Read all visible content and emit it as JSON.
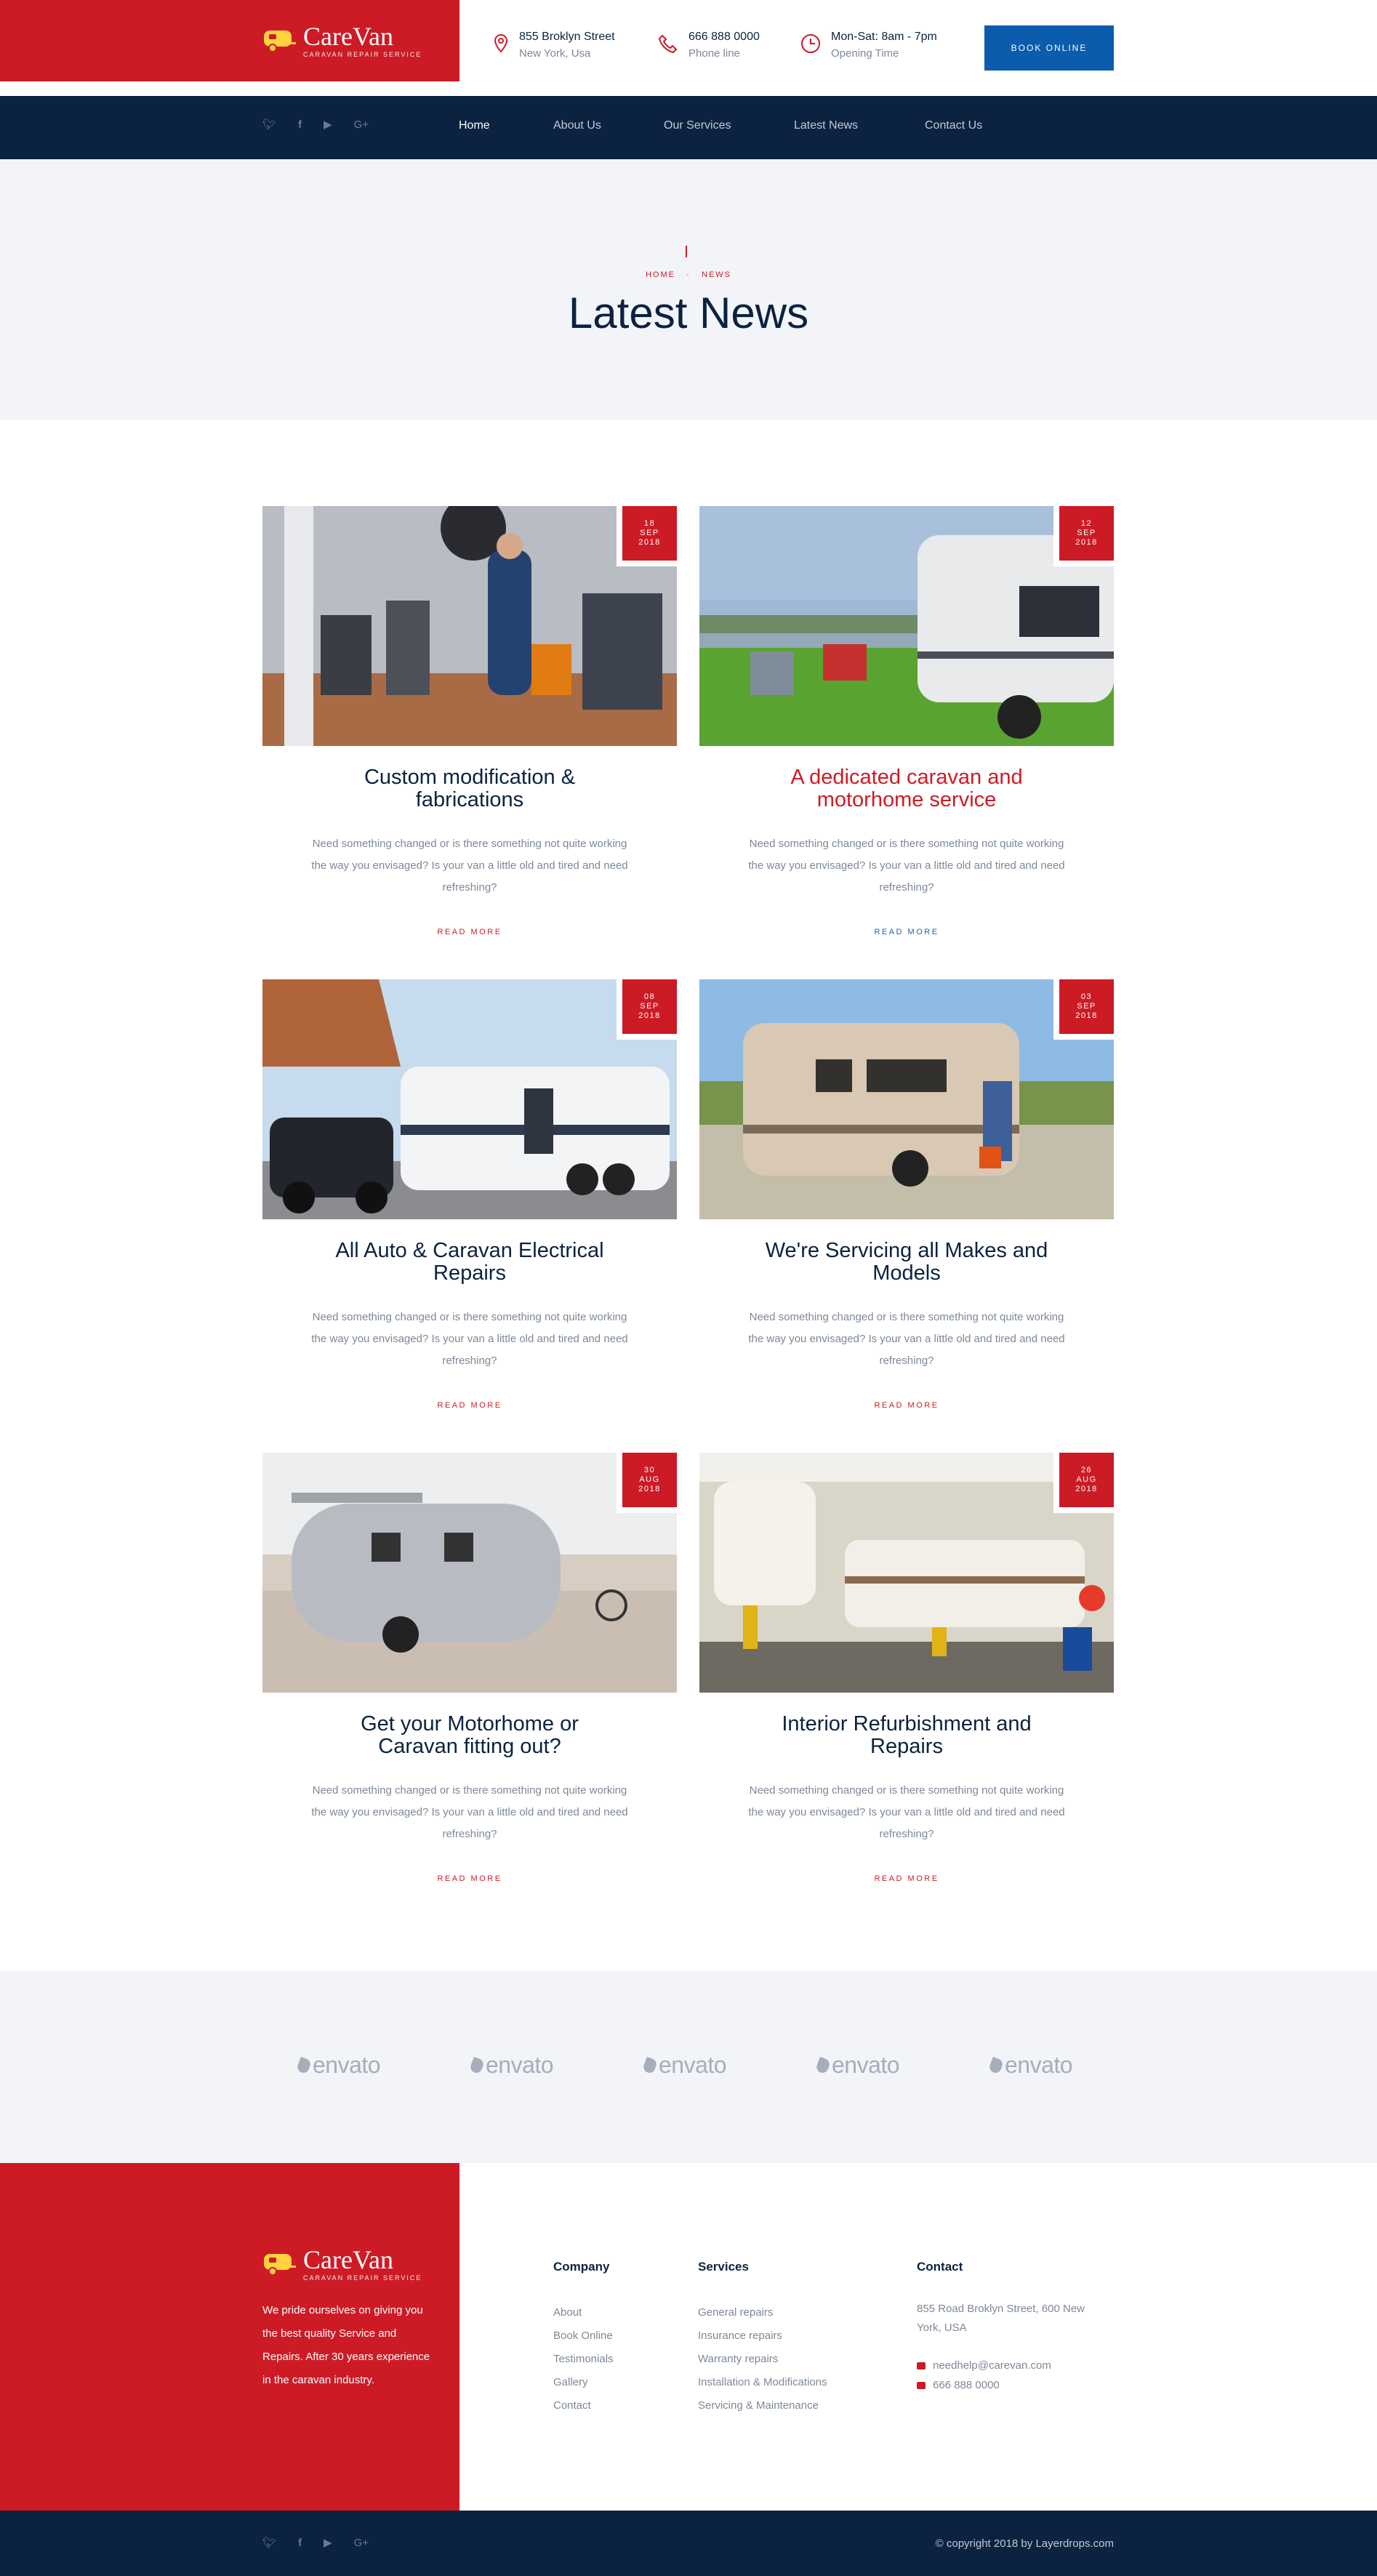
{
  "brand": {
    "name": "CareVan",
    "tagline": "Caravan Repair Service",
    "logo_color": "#ffd23e"
  },
  "colors": {
    "red": "#cd1b26",
    "navy": "#0b2240",
    "blue": "#0b5cad",
    "light": "#f2f4f8"
  },
  "header": {
    "address": {
      "line1": "855 Broklyn Street",
      "line2": "New York, Usa",
      "icon": "map-pin-icon"
    },
    "phone": {
      "line1": "666 888 0000",
      "line2": "Phone line",
      "icon": "phone-icon"
    },
    "hours": {
      "line1": "Mon-Sat: 8am - 7pm",
      "line2": "Opening Time",
      "icon": "clock-icon"
    },
    "book_label": "BOOK ONLINE"
  },
  "social": [
    "twitter",
    "facebook",
    "youtube",
    "google-plus"
  ],
  "nav": [
    "Home",
    "About Us",
    "Our Services",
    "Latest News",
    "Contact Us"
  ],
  "hero": {
    "breadcrumb_home": "HOME",
    "breadcrumb_current": "NEWS",
    "title": "Latest News"
  },
  "posts": [
    {
      "day": "18",
      "month": "SEP",
      "year": "2018",
      "title": "Custom modification & fabrications",
      "desc": "Need something changed or is there something not quite working the way you envisaged? Is your van a little old and tired and need refreshing?",
      "more": "READ MORE"
    },
    {
      "day": "12",
      "month": "SEP",
      "year": "2018",
      "title": "A dedicated caravan and motorhome service",
      "desc": "Need something changed or is there something not quite working the way you envisaged? Is your van a little old and tired and need refreshing?",
      "more": "READ MORE"
    },
    {
      "day": "08",
      "month": "SEP",
      "year": "2018",
      "title": "All Auto & Caravan Electrical Repairs",
      "desc": "Need something changed or is there something not quite working the way you envisaged? Is your van a little old and tired and need refreshing?",
      "more": "READ MORE"
    },
    {
      "day": "03",
      "month": "SEP",
      "year": "2018",
      "title": "We're Servicing all Makes and Models",
      "desc": "Need something changed or is there something not quite working the way you envisaged? Is your van a little old and tired and need refreshing?",
      "more": "READ MORE"
    },
    {
      "day": "30",
      "month": "AUG",
      "year": "2018",
      "title": "Get your Motorhome or Caravan fitting out?",
      "desc": "Need something changed or is there something not quite working the way you envisaged? Is your van a little old and tired and need refreshing?",
      "more": "READ MORE"
    },
    {
      "day": "26",
      "month": "AUG",
      "year": "2018",
      "title": "Interior Refurbishment and Repairs",
      "desc": "Need something changed or is there something not quite working the way you envisaged? Is your van a little old and tired and need refreshing?",
      "more": "READ MORE"
    }
  ],
  "partners": [
    "envato",
    "envato",
    "envato",
    "envato",
    "envato"
  ],
  "footer": {
    "about": "We pride ourselves on giving you the best quality Service and Repairs. After 30 years experience in the caravan industry.",
    "company_title": "Company",
    "company_links": [
      "About",
      "Book Online",
      "Testimonials",
      "Gallery",
      "Contact"
    ],
    "services_title": "Services",
    "services_links": [
      "General repairs",
      "Insurance repairs",
      "Warranty repairs",
      "Installation & Modifications",
      "Servicing & Maintenance"
    ],
    "contact_title": "Contact",
    "contact_address": "855 Road Broklyn Street, 600 New York, USA",
    "contact_email": "needhelp@carevan.com",
    "contact_phone": "666 888 0000",
    "copyright": "© copyright 2018 by Layerdrops.com"
  }
}
